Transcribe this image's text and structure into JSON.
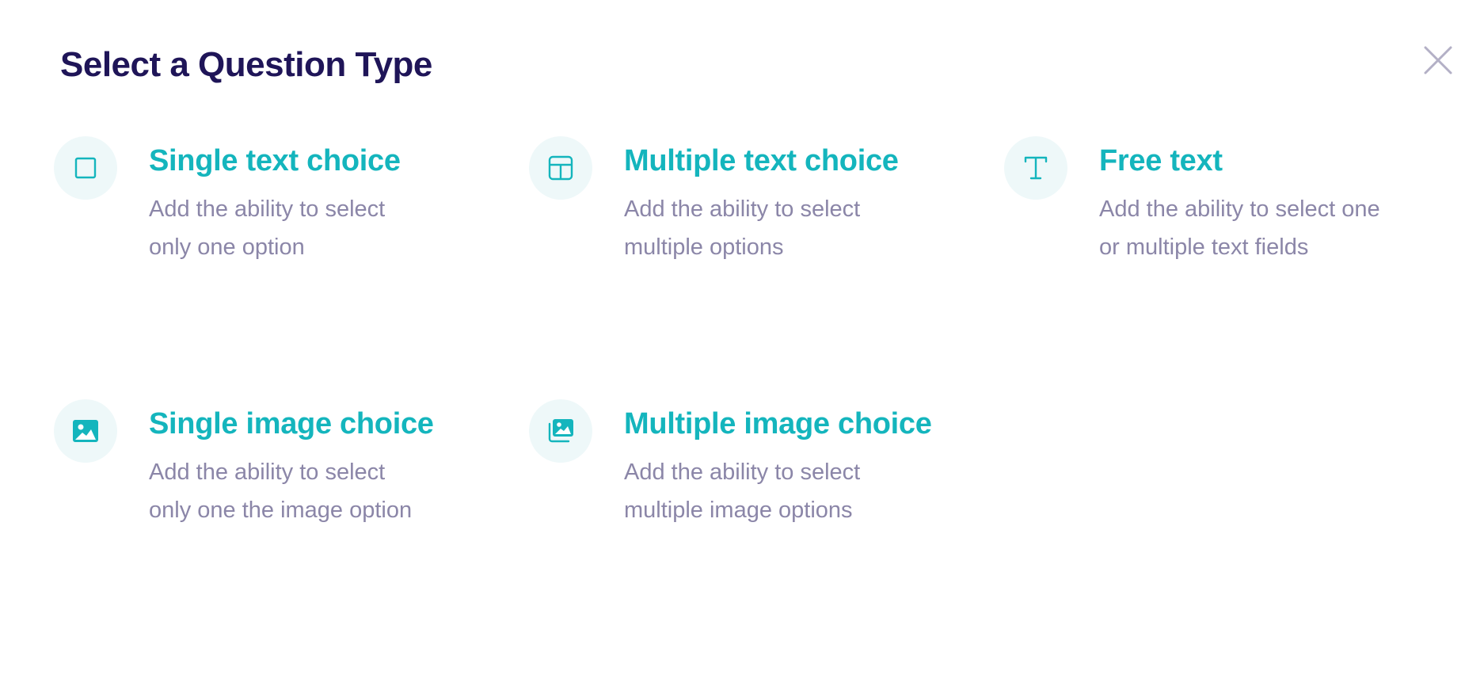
{
  "modal": {
    "title": "Select a Question Type",
    "close_icon": "close-icon"
  },
  "colors": {
    "title": "#1f1558",
    "accent": "#14b5bd",
    "description": "#8b86a8",
    "icon_background": "#eef8f9",
    "close": "#b3b0c6"
  },
  "options": [
    {
      "icon": "square-icon",
      "title": "Single text choice",
      "description_line1": "Add the ability to select",
      "description_line2": "only one option"
    },
    {
      "icon": "grid-icon",
      "title": "Multiple text choice",
      "description_line1": "Add the ability to select",
      "description_line2": "multiple options"
    },
    {
      "icon": "text-t-icon",
      "title": "Free text",
      "description_line1": "Add the ability to select one",
      "description_line2": "or multiple text fields"
    },
    {
      "icon": "image-icon",
      "title": "Single image choice",
      "description_line1": "Add the ability to select",
      "description_line2": "only one the image option"
    },
    {
      "icon": "images-stack-icon",
      "title": "Multiple image choice",
      "description_line1": "Add the ability to select",
      "description_line2": "multiple image options"
    }
  ]
}
